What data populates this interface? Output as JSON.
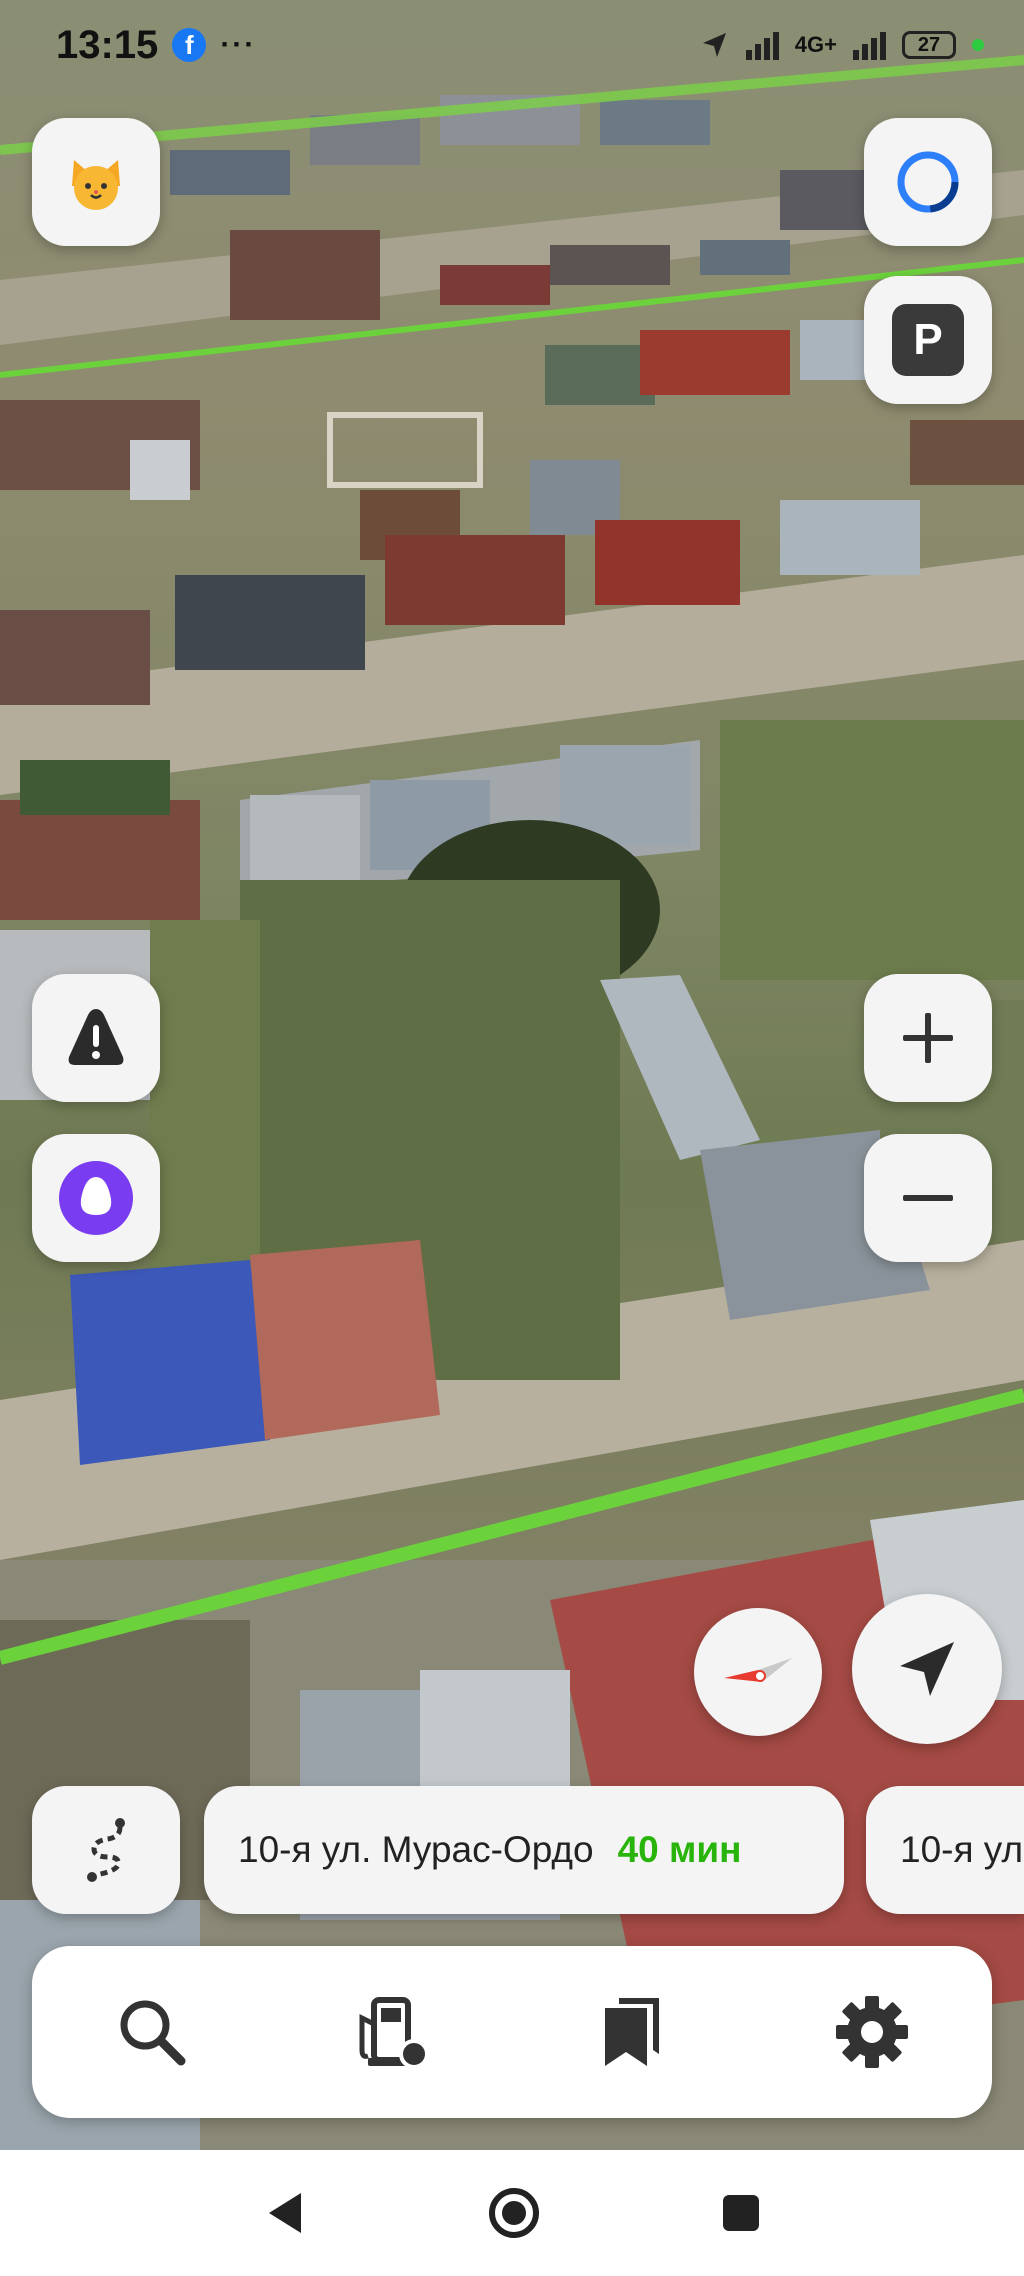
{
  "status_bar": {
    "time": "13:15",
    "fb_badge": "f",
    "overflow": "···",
    "network": "4G+",
    "battery": "27"
  },
  "route_suggestions": [
    {
      "destination": "10-я ул. Мурас-Ордо",
      "eta": "40 мин"
    },
    {
      "destination": "10-я ул"
    }
  ],
  "parking_label": "P",
  "icons": {
    "avatar": "cat-face-icon",
    "alice_circle": "alice-ring-icon",
    "parking": "parking-icon",
    "report": "road-alert-icon",
    "alice": "alice-icon",
    "zoom_in": "plus-icon",
    "zoom_out": "minus-icon",
    "compass": "compass-icon",
    "locate": "location-arrow-icon",
    "routes": "route-icon",
    "search": "search-icon",
    "fuel": "fuel-station-icon",
    "bookmarks": "bookmarks-icon",
    "settings": "gear-icon"
  },
  "colors": {
    "route_eta": "#28b40a",
    "map_line": "#6cd23c",
    "alice": "#7a3cf0"
  }
}
